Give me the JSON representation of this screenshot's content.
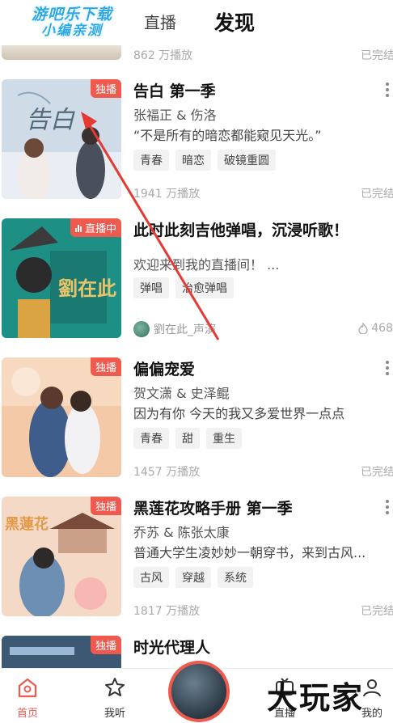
{
  "watermark": {
    "line1": "游吧乐下载",
    "line2": "小编亲测"
  },
  "header": {
    "tab_live": "直播",
    "tab_discover": "发现"
  },
  "partial_row": {
    "plays": "862 万播放",
    "status": "已完结"
  },
  "items": [
    {
      "badge": "独播",
      "title": "告白 第一季",
      "authors": "张福正 & 伤洛",
      "desc": "“不是所有的暗恋都能窥见天光。”",
      "tags": [
        "青春",
        "暗恋",
        "破镜重圆"
      ],
      "plays": "1941 万播放",
      "status": "已完结"
    },
    {
      "badge": "直播中",
      "title": "此时此刻吉他弹唱，沉浸听歌！",
      "desc": "欢迎来到我的直播间！ ...",
      "tags": [
        "弹唱",
        "治愈弹唱"
      ],
      "host": "劉在此_声演",
      "heat": "468"
    },
    {
      "badge": "独播",
      "title": "偏偏宠爱",
      "authors": "贺文潇 & 史泽鲲",
      "desc": "因为有你 今天的我又多爱世界一点点",
      "tags": [
        "青春",
        "甜",
        "重生"
      ],
      "plays": "1457 万播放",
      "status": "已完结"
    },
    {
      "badge": "独播",
      "title": "黑莲花攻略手册 第一季",
      "authors": "乔苏 & 陈张太康",
      "desc": "普通大学生凌妙妙一朝穿书，来到古风...",
      "tags": [
        "古风",
        "穿越",
        "系统"
      ],
      "plays": "1817 万播放",
      "status": "已完结"
    },
    {
      "badge": "独播",
      "title": "时光代理人"
    }
  ],
  "nav": {
    "home": "首页",
    "listen": "我听",
    "live": "直播",
    "mine": "我的"
  },
  "corner_text": "大玩家",
  "colors": {
    "accent": "#ef5a4f"
  }
}
